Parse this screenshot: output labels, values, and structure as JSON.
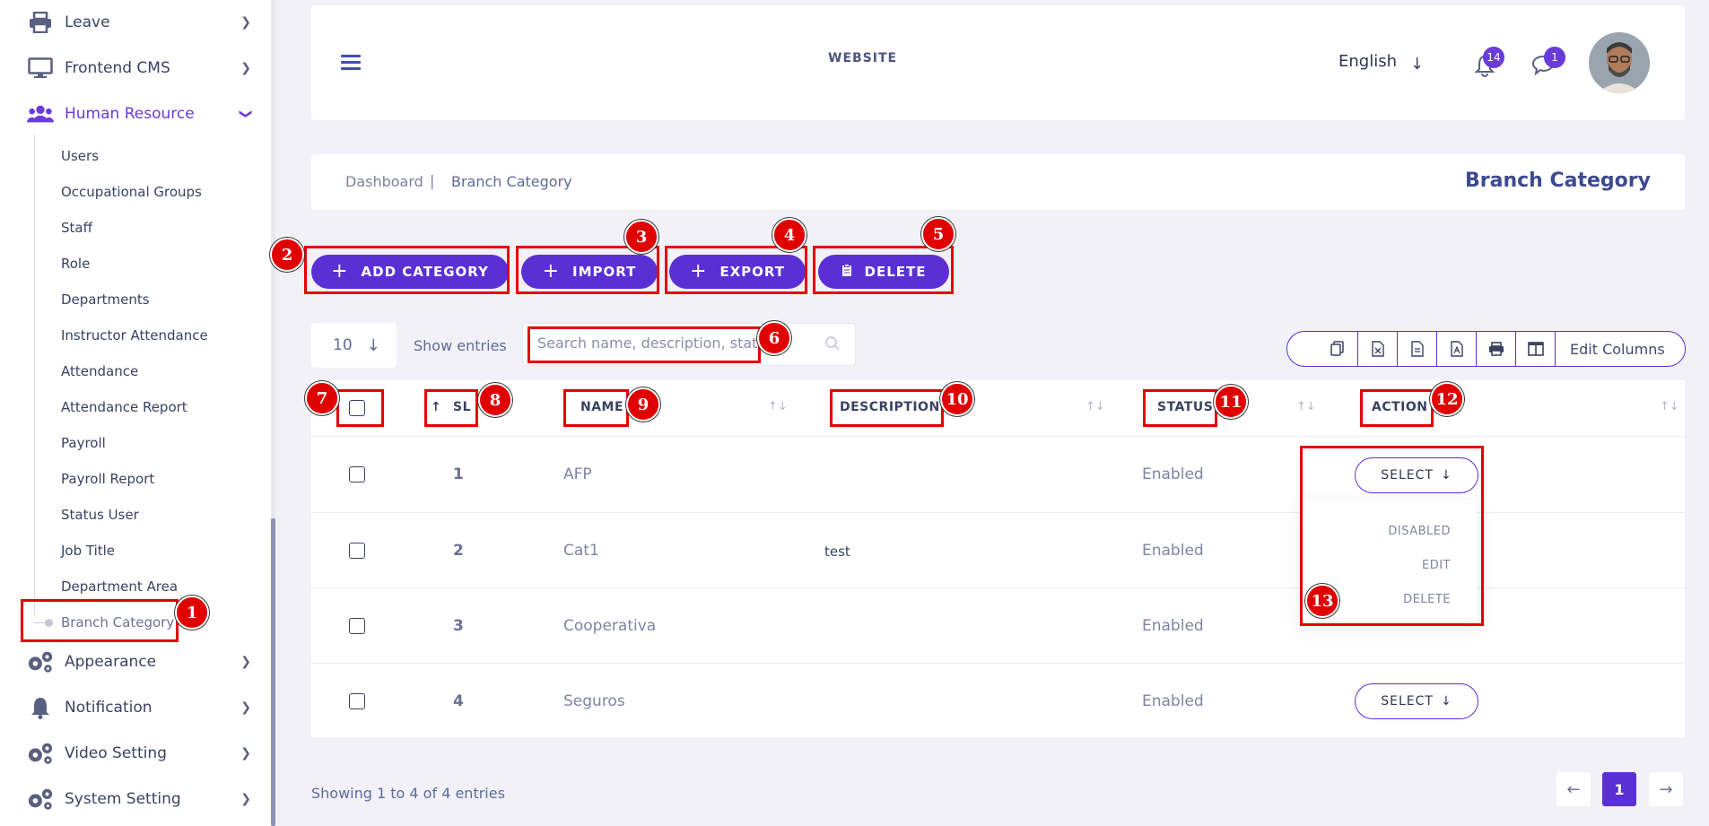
{
  "sidebar": {
    "menu": [
      {
        "label": "Leave",
        "icon": "printer-icon"
      },
      {
        "label": "Frontend CMS",
        "icon": "monitor-icon"
      },
      {
        "label": "Human Resource",
        "icon": "users-icon"
      },
      {
        "label": "Appearance",
        "icon": "gears-icon"
      },
      {
        "label": "Notification",
        "icon": "bell-icon"
      },
      {
        "label": "Video Setting",
        "icon": "gears-icon"
      },
      {
        "label": "System Setting",
        "icon": "gears-icon"
      }
    ],
    "submenu": [
      "Users",
      "Occupational Groups",
      "Staff",
      "Role",
      "Departments",
      "Instructor Attendance",
      "Attendance",
      "Attendance Report",
      "Payroll",
      "Payroll Report",
      "Status User",
      "Job Title",
      "Department Area",
      "Branch Category"
    ]
  },
  "header": {
    "title": "WEBSITE",
    "language": "English",
    "notif_count": "14",
    "msg_count": "1"
  },
  "breadcrumb": {
    "home": "Dashboard",
    "sep": "|",
    "current": "Branch Category",
    "page_title": "Branch Category"
  },
  "actions": {
    "add": "ADD CATEGORY",
    "import": "IMPORT",
    "export": "EXPORT",
    "delete": "DELETE"
  },
  "controls": {
    "entries_value": "10",
    "show_entries": "Show entries",
    "search_placeholder": "Search name, description, status",
    "edit_columns": "Edit Columns"
  },
  "table": {
    "headers": {
      "sl": "SL",
      "name": "NAME",
      "description": "DESCRIPTION",
      "status": "STATUS",
      "action": "ACTION"
    },
    "rows": [
      {
        "sl": "1",
        "name": "AFP",
        "description": "",
        "status": "Enabled"
      },
      {
        "sl": "2",
        "name": "Cat1",
        "description": "test",
        "status": "Enabled"
      },
      {
        "sl": "3",
        "name": "Cooperativa",
        "description": "",
        "status": "Enabled"
      },
      {
        "sl": "4",
        "name": "Seguros",
        "description": "",
        "status": "Enabled"
      }
    ],
    "select_label": "SELECT",
    "dropdown": [
      "DISABLED",
      "EDIT",
      "DELETE"
    ]
  },
  "footer": {
    "showing": "Showing 1 to 4 of 4 entries",
    "page": "1"
  },
  "annotations": [
    "1",
    "2",
    "3",
    "4",
    "5",
    "6",
    "7",
    "8",
    "9",
    "10",
    "11",
    "12",
    "13"
  ],
  "colors": {
    "accent": "#5a2fd4",
    "annotation": "#e60000"
  }
}
